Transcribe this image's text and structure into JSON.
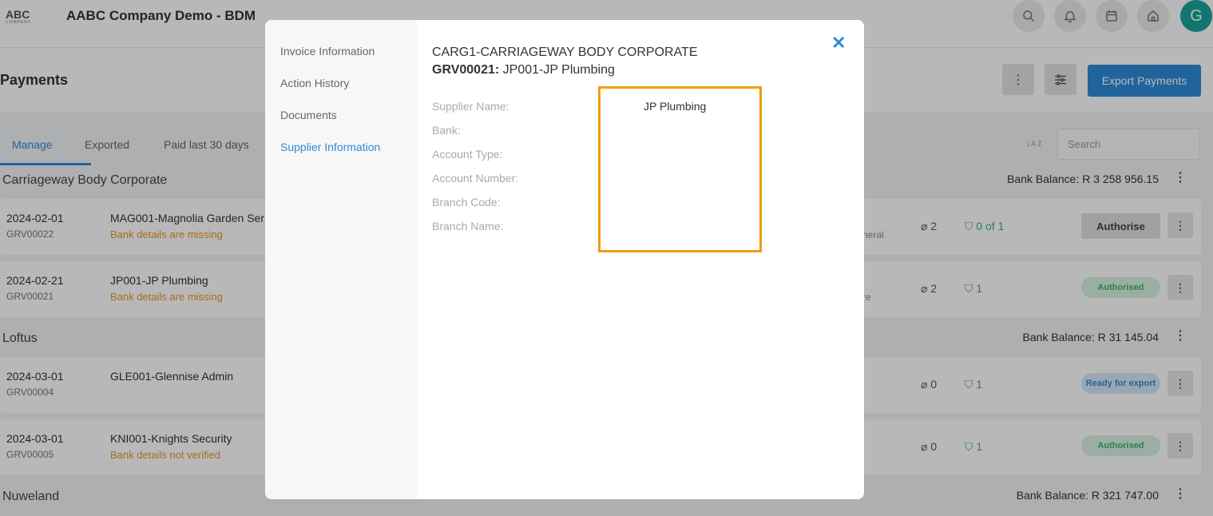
{
  "app": {
    "logo_text": "ABC",
    "logo_sub": "COMPANY",
    "company_name": "AABC Company Demo - BDM",
    "avatar_initial": "G",
    "top_icons": [
      "search-icon",
      "bell-icon",
      "calendar-icon",
      "home-icon"
    ]
  },
  "page": {
    "title": "Payments",
    "export_label": "Export Payments",
    "search_placeholder": "Search"
  },
  "tabs": [
    "Manage",
    "Exported",
    "Paid last 30 days"
  ],
  "groups": [
    {
      "name": "Carriageway Body Corporate",
      "balance": "Bank Balance: R 3 258 956.15",
      "rows": [
        {
          "date": "2024-02-01",
          "ref": "GRV00022",
          "supplier": "MAG001-Magnolia Garden Ser",
          "warning": "Bank details are missing",
          "fragment": "neral",
          "attachments": "2",
          "approvals": "0 of 1",
          "action": "Authorise"
        },
        {
          "date": "2024-02-21",
          "ref": "GRV00021",
          "supplier": "JP001-JP Plumbing",
          "warning": "Bank details are missing",
          "fragment": "re",
          "attachments": "2",
          "approvals": "1",
          "status": "Authorised"
        }
      ]
    },
    {
      "name": "Loftus",
      "balance": "Bank Balance: R 31 145.04",
      "rows": [
        {
          "date": "2024-03-01",
          "ref": "GRV00004",
          "supplier": "GLE001-Glennise Admin",
          "warning": "",
          "attachments": "0",
          "approvals": "1",
          "status": "Ready for export"
        },
        {
          "date": "2024-03-01",
          "ref": "GRV00005",
          "supplier": "KNI001-Knights Security",
          "warning": "Bank details not verified",
          "attachments": "0",
          "approvals": "1",
          "status": "Authorised"
        }
      ]
    },
    {
      "name": "Nuweland",
      "balance": "Bank Balance: R 321 747.00"
    }
  ],
  "modal": {
    "nav": [
      "Invoice Information",
      "Action History",
      "Documents",
      "Supplier Information"
    ],
    "active_nav": "Supplier Information",
    "close_glyph": "✕",
    "title": "CARG1-CARRIAGEWAY BODY CORPORATE",
    "sub_ref": "GRV00021:",
    "sub_supplier": "JP001-JP Plumbing",
    "fields": [
      {
        "label": "Supplier Name:",
        "value": "JP Plumbing"
      },
      {
        "label": "Bank:",
        "value": ""
      },
      {
        "label": "Account Type:",
        "value": ""
      },
      {
        "label": "Account Number:",
        "value": ""
      },
      {
        "label": "Branch Code:",
        "value": ""
      },
      {
        "label": "Branch Name:",
        "value": ""
      }
    ]
  },
  "colors": {
    "accent": "#2e8bd8",
    "warning": "#e8962c",
    "success": "#3bb36b",
    "highlight": "#f39c12"
  }
}
